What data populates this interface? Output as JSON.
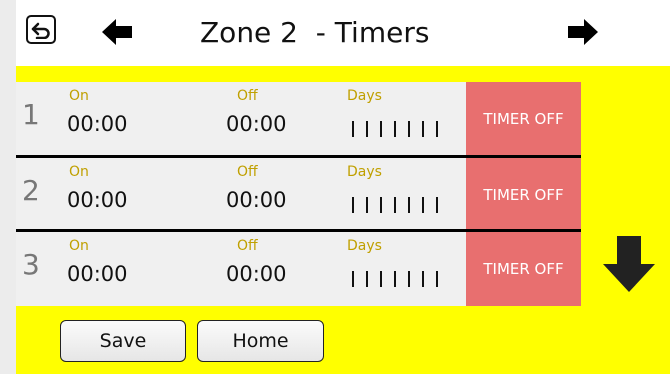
{
  "header": {
    "title": "Zone 2  - Timers",
    "icons": {
      "back": "return-arrow-icon",
      "prev": "arrow-left-icon",
      "next": "arrow-right-icon"
    }
  },
  "labels": {
    "on": "On",
    "off": "Off",
    "days": "Days"
  },
  "timers": [
    {
      "num": "1",
      "on": "00:00",
      "off": "00:00",
      "days_ticks": 7,
      "status": "TIMER OFF"
    },
    {
      "num": "2",
      "on": "00:00",
      "off": "00:00",
      "days_ticks": 7,
      "status": "TIMER OFF"
    },
    {
      "num": "3",
      "on": "00:00",
      "off": "00:00",
      "days_ticks": 7,
      "status": "TIMER OFF"
    }
  ],
  "scroll": {
    "icon": "arrow-down-icon"
  },
  "footer": {
    "save_label": "Save",
    "home_label": "Home"
  },
  "colors": {
    "background": "#ffff00",
    "header": "#ffffff",
    "row": "#f0f0f0",
    "timer_off": "#e86f6f",
    "label": "#c0a000"
  }
}
